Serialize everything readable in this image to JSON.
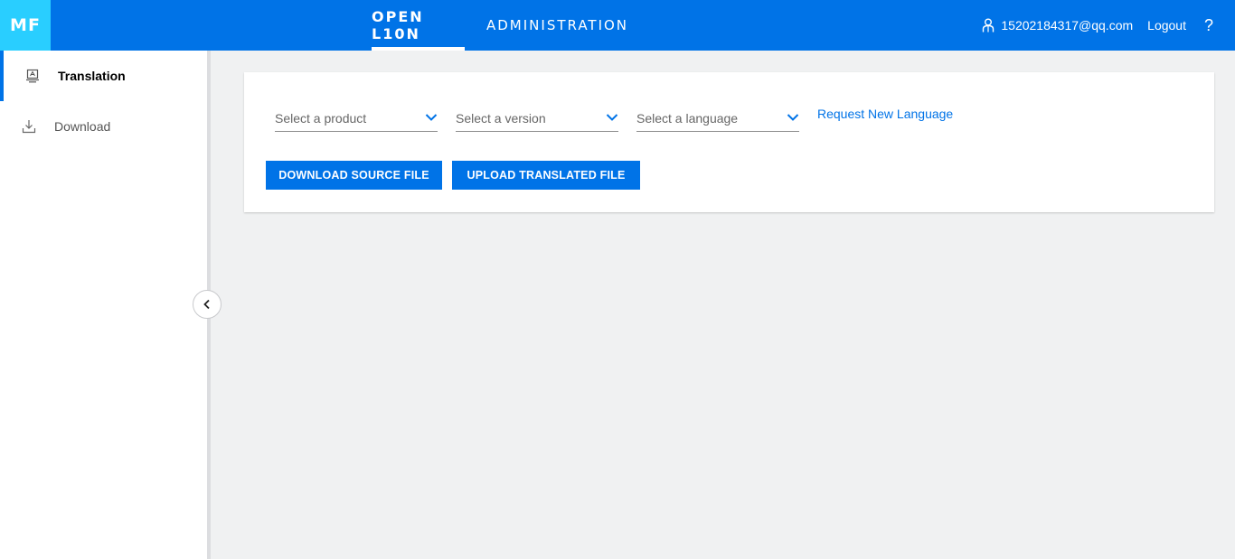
{
  "logo": "MF",
  "header": {
    "tabs": [
      {
        "label": "OPEN L10N",
        "active": true
      },
      {
        "label": "ADMINISTRATION",
        "active": false
      }
    ],
    "user_email": "15202184317@qq.com",
    "logout_label": "Logout",
    "help_label": "?"
  },
  "sidebar": {
    "items": [
      {
        "label": "Translation",
        "icon": "monitor-icon",
        "active": true
      },
      {
        "label": "Download",
        "icon": "download-icon",
        "active": false
      }
    ],
    "collapse_icon": "chevron-left-icon"
  },
  "main": {
    "selects": [
      {
        "placeholder": "Select a product",
        "icon": "chevron-down-icon"
      },
      {
        "placeholder": "Select a version",
        "icon": "chevron-down-icon"
      },
      {
        "placeholder": "Select a language",
        "icon": "chevron-down-icon"
      }
    ],
    "request_link": "Request New Language",
    "download_button": "DOWNLOAD SOURCE FILE",
    "upload_button": "UPLOAD TRANSLATED FILE"
  },
  "colors": {
    "header_bg": "#0073e7",
    "logo_bg": "#29ceff",
    "accent": "#0073e7",
    "page_bg": "#f0f1f2"
  }
}
